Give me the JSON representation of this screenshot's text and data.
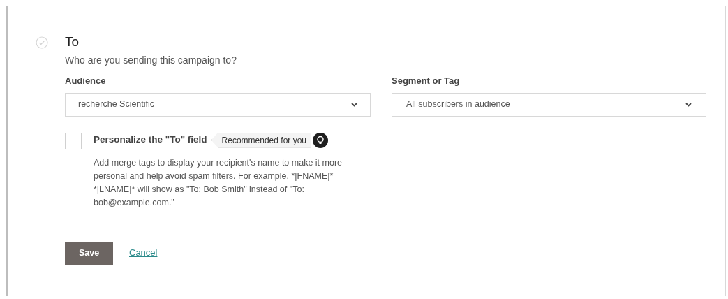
{
  "section": {
    "title": "To",
    "subtitle": "Who are you sending this campaign to?",
    "completed": false
  },
  "audience": {
    "label": "Audience",
    "value": "recherche Scientific"
  },
  "segment": {
    "label": "Segment or Tag",
    "value": "All subscribers in audience"
  },
  "personalize": {
    "label": "Personalize the \"To\" field",
    "checked": false,
    "badge": "Recommended for you",
    "description": "Add merge tags to display your recipient's name to make it more personal and help avoid spam filters. For example, *|FNAME|* *|LNAME|* will show as \"To: Bob Smith\" instead of \"To: bob@example.com.\""
  },
  "buttons": {
    "save": "Save",
    "cancel": "Cancel"
  }
}
